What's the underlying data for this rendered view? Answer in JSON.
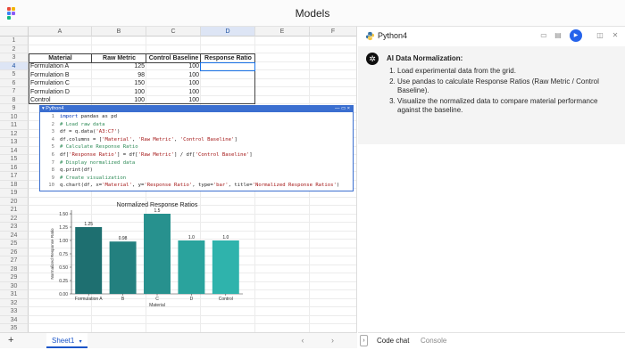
{
  "app": {
    "title": "Models"
  },
  "sheet": {
    "columns": [
      "A",
      "B",
      "C",
      "D",
      "E",
      "F"
    ],
    "selected_column": "D",
    "rows": [
      "1",
      "2",
      "3",
      "4",
      "5",
      "6",
      "7",
      "8",
      "9",
      "10",
      "11",
      "12",
      "13",
      "14",
      "15",
      "16",
      "17",
      "18",
      "19",
      "20",
      "21",
      "22",
      "23",
      "24",
      "25",
      "26",
      "27",
      "28",
      "29",
      "30",
      "31",
      "32",
      "33",
      "34",
      "35"
    ],
    "selected_row": "4",
    "table": {
      "headers": [
        "Material",
        "Raw Metric",
        "Control Baseline",
        "Response Ratio"
      ],
      "rows": [
        [
          "Formulation A",
          "125",
          "100",
          ""
        ],
        [
          "Formulation B",
          "98",
          "100",
          ""
        ],
        [
          "Formulation C",
          "150",
          "100",
          ""
        ],
        [
          "Formulation D",
          "100",
          "100",
          ""
        ],
        [
          "Control",
          "100",
          "100",
          ""
        ]
      ]
    },
    "tab": {
      "name": "Sheet1"
    },
    "add_sheet_label": "+",
    "nav_arrows": "‹ ›"
  },
  "code": {
    "block_title": "Python4",
    "block_controls": "— ▭ ×",
    "lines": [
      {
        "n": "1",
        "parts": [
          {
            "k": "kw",
            "t": "import"
          },
          {
            "k": "",
            "t": " pandas as pd"
          }
        ]
      },
      {
        "n": "2",
        "parts": [
          {
            "k": "cm",
            "t": "# Load raw data"
          }
        ]
      },
      {
        "n": "3",
        "parts": [
          {
            "k": "",
            "t": "df = q.data("
          },
          {
            "k": "st",
            "t": "'A3:C7'"
          },
          {
            "k": "",
            "t": ")"
          }
        ]
      },
      {
        "n": "4",
        "parts": [
          {
            "k": "",
            "t": "df.columns = ["
          },
          {
            "k": "st",
            "t": "'Material'"
          },
          {
            "k": "",
            "t": ", "
          },
          {
            "k": "st",
            "t": "'Raw Metric'"
          },
          {
            "k": "",
            "t": ", "
          },
          {
            "k": "st",
            "t": "'Control Baseline'"
          },
          {
            "k": "",
            "t": "]"
          }
        ]
      },
      {
        "n": "5",
        "parts": [
          {
            "k": "cm",
            "t": "# Calculate Response Ratio"
          }
        ]
      },
      {
        "n": "6",
        "parts": [
          {
            "k": "",
            "t": "df["
          },
          {
            "k": "st",
            "t": "'Response Ratio'"
          },
          {
            "k": "",
            "t": "] = df["
          },
          {
            "k": "st",
            "t": "'Raw Metric'"
          },
          {
            "k": "",
            "t": "] / df["
          },
          {
            "k": "st",
            "t": "'Control Baseline'"
          },
          {
            "k": "",
            "t": "]"
          }
        ]
      },
      {
        "n": "7",
        "parts": [
          {
            "k": "cm",
            "t": "# Display normalized data"
          }
        ]
      },
      {
        "n": "8",
        "parts": [
          {
            "k": "",
            "t": "q.print(df)"
          }
        ]
      },
      {
        "n": "9",
        "parts": [
          {
            "k": "cm",
            "t": "# Create visualization"
          }
        ]
      },
      {
        "n": "10",
        "parts": [
          {
            "k": "",
            "t": "q.chart(df, x="
          },
          {
            "k": "st",
            "t": "'Material'"
          },
          {
            "k": "",
            "t": ", y="
          },
          {
            "k": "st",
            "t": "'Response Ratio'"
          },
          {
            "k": "",
            "t": ", type="
          },
          {
            "k": "st",
            "t": "'bar'"
          },
          {
            "k": "",
            "t": ", title="
          },
          {
            "k": "st",
            "t": "'Normalized Response Ratios'"
          },
          {
            "k": "",
            "t": ")"
          }
        ]
      }
    ]
  },
  "chart_data": {
    "type": "bar",
    "title": "Normalized Response Ratios",
    "xlabel": "Material",
    "ylabel": "Normalized Response Ratio",
    "categories": [
      "Formulation A",
      "B",
      "C",
      "D",
      "Control"
    ],
    "values": [
      1.25,
      0.98,
      1.5,
      1.0,
      1.0
    ],
    "value_labels": [
      "1.25",
      "0.98",
      "1.5",
      "1.0",
      "1.0"
    ],
    "yticks": [
      "0.00",
      "0.25",
      "0.50",
      "0.75",
      "1.00",
      "1.25",
      "1.50"
    ],
    "ylim": [
      0,
      1.5
    ],
    "colors": [
      "#1e6f70",
      "#23807f",
      "#27918e",
      "#2aa39d",
      "#2fb3ac"
    ],
    "grid": false
  },
  "panel": {
    "title": "Python4",
    "icons": [
      "monitor-icon",
      "clipboard-icon",
      "run-icon",
      "split-icon",
      "close-icon"
    ],
    "message": {
      "title": "AI Data Normalization:",
      "items": [
        "Load experimental data from the grid.",
        "Use pandas to calculate Response Ratios (Raw Metric / Control Baseline).",
        "Visualize the normalized data to compare material performance against the baseline."
      ]
    },
    "tabs": {
      "chat": "Code chat",
      "console": "Console"
    }
  },
  "colors": {
    "accent": "#2563eb",
    "selection": "#1a73e8",
    "code_border": "#3b6fd0"
  }
}
